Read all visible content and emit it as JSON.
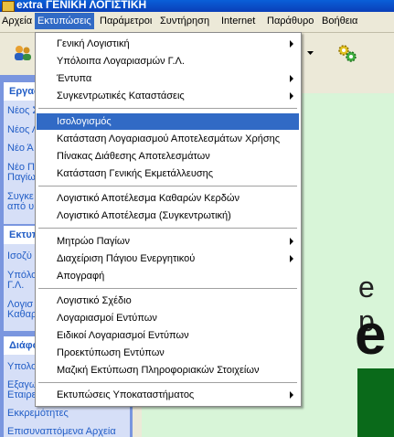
{
  "window": {
    "title": "extra ΓΕΝΙΚΗ ΛΟΓΙΣΤΙΚΗ"
  },
  "menubar": [
    {
      "label": "Αρχεία"
    },
    {
      "label": "Εκτυπώσεις"
    },
    {
      "label": "Παράμετροι"
    },
    {
      "label": "Συντήρηση"
    },
    {
      "label": "Internet"
    },
    {
      "label": "Παράθυρο"
    },
    {
      "label": "Βοήθεια"
    }
  ],
  "sidebar": {
    "sections": [
      {
        "header": "Εργασ",
        "items": [
          "Νέος Σ",
          "Νέος Λ",
          "Νέο Ά",
          "Νέο Π",
          "Παγίω",
          "Συγκε",
          "από υ"
        ]
      },
      {
        "header": "Εκτυπ",
        "items": [
          "Ισοζύ",
          "Υπόλο",
          "Γ.Λ.",
          "Λογισ",
          "Καθαρ"
        ]
      },
      {
        "header": "Διάφο",
        "items": [
          "Υπολο",
          "Εξαγω",
          "Εταιρε",
          "Εκκρεμότητες",
          "Επισυναπτόμενα Αρχεία"
        ]
      }
    ]
  },
  "main": {
    "brand_text_1": "e p",
    "brand_text_2": "e"
  },
  "dropdown": {
    "items": [
      {
        "label": "Γενική Λογιστική",
        "submenu": true
      },
      {
        "label": "Υπόλοιπα Λογαριασμών Γ.Λ.",
        "submenu": false
      },
      {
        "label": "Έντυπα",
        "submenu": true
      },
      {
        "label": "Συγκεντρωτικές Καταστάσεις",
        "submenu": true
      },
      {
        "label": "Ισολογισμός",
        "submenu": false,
        "selected": true
      },
      {
        "label": "Κατάσταση Λογαριασμού Αποτελεσμάτων Χρήσης",
        "submenu": false
      },
      {
        "label": "Πίνακας Διάθεσης Αποτελεσμάτων",
        "submenu": false
      },
      {
        "label": "Κατάσταση Γενικής Εκμετάλλευσης",
        "submenu": false
      },
      {
        "label": "Λογιστικό Αποτέλεσμα Καθαρών Κερδών",
        "submenu": false
      },
      {
        "label": "Λογιστικό Αποτέλεσμα (Συγκεντρωτική)",
        "submenu": false
      },
      {
        "label": "Μητρώο Παγίων",
        "submenu": true
      },
      {
        "label": "Διαχείριση Πάγιου Ενεργητικού",
        "submenu": true
      },
      {
        "label": "Απογραφή",
        "submenu": false
      },
      {
        "label": "Λογιστικό Σχέδιο",
        "submenu": false
      },
      {
        "label": "Λογαριασμοί Εντύπων",
        "submenu": false
      },
      {
        "label": "Ειδικοί Λογαριασμοί Εντύπων",
        "submenu": false
      },
      {
        "label": "Προεκτύπωση Εντύπων",
        "submenu": false
      },
      {
        "label": "Μαζική Εκτύπωση Πληροφοριακών Στοιχείων",
        "submenu": false
      },
      {
        "label": "Εκτυπώσεις Υποκαταστήματος",
        "submenu": true
      }
    ]
  }
}
